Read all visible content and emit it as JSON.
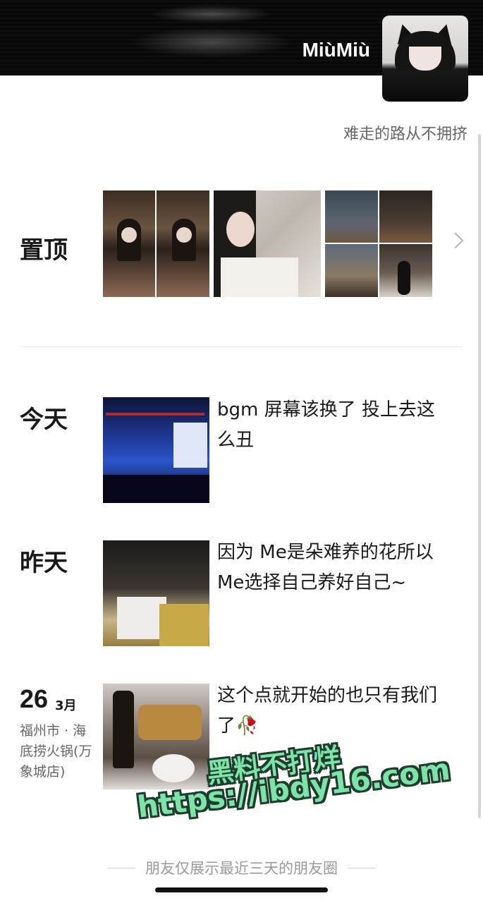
{
  "profile": {
    "nickname": "MiùMiù",
    "signature": "难走的路从不拥挤"
  },
  "pinned": {
    "label": "置顶"
  },
  "posts": [
    {
      "day": "今天",
      "text": "bgm 屏幕该换了 投上去这么丑"
    },
    {
      "day": "昨天",
      "text": "因为 Me是朵难养的花所以 Me选择自己养好自己~"
    },
    {
      "day_number": "26",
      "month": "3月",
      "location": "福州市 · 海底捞火锅(万象城店)",
      "text": "这个点就开始的也只有我们了🥀"
    }
  ],
  "watermark": {
    "line1": "黑料不打烊",
    "line2": "https://ibdy16.com"
  },
  "footer": {
    "text": "朋友仅展示最近三天的朋友圈"
  },
  "icons": {
    "more": "chevron-right-icon"
  }
}
